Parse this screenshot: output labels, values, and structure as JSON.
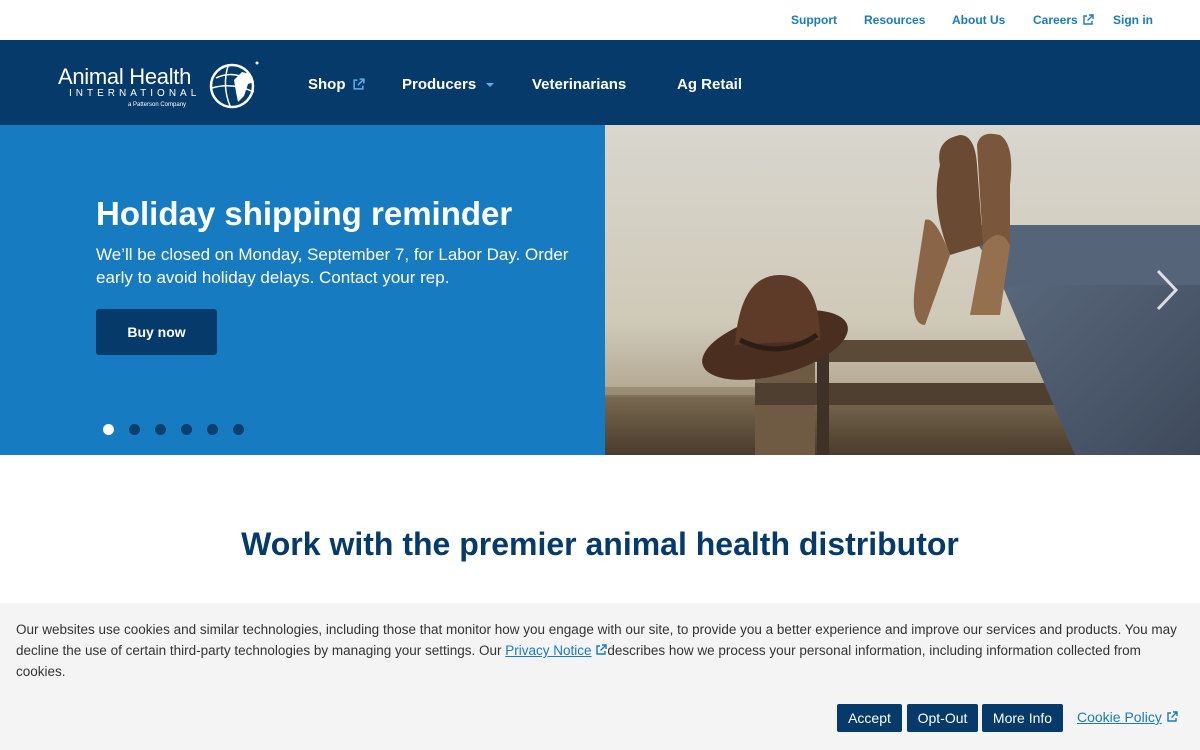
{
  "utility_nav": {
    "support": "Support",
    "resources": "Resources",
    "about_us": "About Us",
    "careers": "Careers",
    "sign_in": "Sign in"
  },
  "logo": {
    "name": "Animal Health",
    "sub": "INTERNATIONAL",
    "tagline": "a Patterson Company"
  },
  "main_nav": {
    "shop": "Shop",
    "producers": "Producers",
    "veterinarians": "Veterinarians",
    "ag_retail": "Ag Retail"
  },
  "hero": {
    "title": "Holiday shipping reminder",
    "text": "We’ll be closed on Monday, September 7, for Labor Day. Order early to avoid holiday delays. Contact your rep.",
    "button_label": "Buy now",
    "slide_count": 6,
    "active_slide": 1
  },
  "headline": "Work with the premier animal health distributor",
  "cookie_banner": {
    "text_before_link": "Our websites use cookies and similar technologies, including those that monitor how you engage with our site, to provide you a better experience and improve our services and products. You may decline the use of certain third-party technologies by managing your settings. Our ",
    "privacy_link": "Privacy Notice",
    "text_after_link": "describes how we process your personal information, including information collected from cookies.",
    "accept": "Accept",
    "opt_out": "Opt-Out",
    "more_info": "More Info",
    "cookie_policy": "Cookie Policy"
  },
  "colors": {
    "navy": "#053a6a",
    "hero_blue": "#167bc0",
    "link_blue": "#1a7abf",
    "banner_bg": "#f4f4f4"
  }
}
